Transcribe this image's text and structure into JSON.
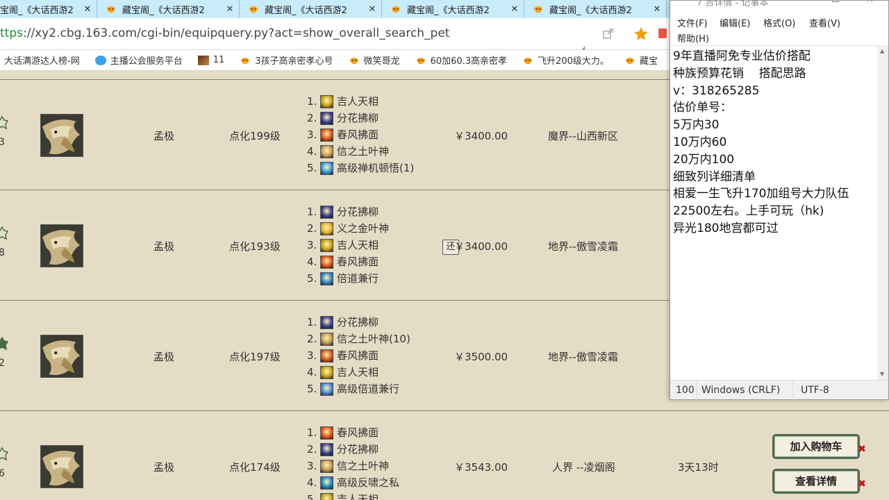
{
  "browser": {
    "tabs": [
      {
        "title": "宝阁_《大话西游2"
      },
      {
        "title": "藏宝阁_《大话西游2"
      },
      {
        "title": "藏宝阁_《大话西游2"
      },
      {
        "title": "藏宝阁_《大话西游2"
      },
      {
        "title": "藏宝阁_《大话西游2"
      },
      {
        "title": "藏宝阁_《大话西游2"
      }
    ],
    "tab_close_glyph": "✕",
    "url_scheme": "ttps",
    "url_rest": "://xy2.cbg.163.com/cgi-bin/equipquery.py?act=show_overall_search_pet",
    "bookmarks": [
      {
        "label": "大话满游达人榜-网",
        "icon": "none"
      },
      {
        "label": "主播公会服务平台",
        "icon": "cloud-icon"
      },
      {
        "label": "11",
        "icon": "game-icon"
      },
      {
        "label": "3孩子高亲密孝心号",
        "icon": "xy2-icon"
      },
      {
        "label": "微笑哥龙",
        "icon": "xy2-icon"
      },
      {
        "label": "60加60.3高亲密孝",
        "icon": "xy2-icon"
      },
      {
        "label": "飞升200级大力。",
        "icon": "xy2-icon"
      },
      {
        "label": "藏宝",
        "icon": "xy2-icon"
      }
    ]
  },
  "listing": {
    "rows": [
      {
        "index": "3",
        "name": "孟极",
        "level": "点化199级",
        "skills": [
          {
            "n": "1.",
            "name": "吉人天相",
            "color": "#c9a21a"
          },
          {
            "n": "2.",
            "name": "分花拂柳",
            "color": "#3a3e8e"
          },
          {
            "n": "3.",
            "name": "春风拂面",
            "color": "#e0541a"
          },
          {
            "n": "4.",
            "name": "信之土叶神",
            "color": "#c79a5a"
          },
          {
            "n": "5.",
            "name": "高级禅机顿悟(1)",
            "color": "#3a9ad8"
          }
        ],
        "bargain": "",
        "price": "￥3400.00",
        "server": "魔界--山西新区",
        "fav_filled": false
      },
      {
        "index": "8",
        "name": "孟极",
        "level": "点化193级",
        "skills": [
          {
            "n": "1.",
            "name": "分花拂柳",
            "color": "#3a3e8e"
          },
          {
            "n": "2.",
            "name": "义之金叶神",
            "color": "#e2b528"
          },
          {
            "n": "3.",
            "name": "吉人天相",
            "color": "#c9a21a"
          },
          {
            "n": "4.",
            "name": "春风拂面",
            "color": "#e0541a"
          },
          {
            "n": "5.",
            "name": "倍道兼行",
            "color": "#2f86c8"
          }
        ],
        "bargain": "还",
        "price": "￥3400.00",
        "server": "地界--傲雪凌霜",
        "fav_filled": false
      },
      {
        "index": "2",
        "name": "孟极",
        "level": "点化197级",
        "skills": [
          {
            "n": "1.",
            "name": "分花拂柳",
            "color": "#3a3e8e"
          },
          {
            "n": "2.",
            "name": "信之土叶神(10)",
            "color": "#c79a5a"
          },
          {
            "n": "3.",
            "name": "春风拂面",
            "color": "#e0541a"
          },
          {
            "n": "4.",
            "name": "吉人天相",
            "color": "#c9a21a"
          },
          {
            "n": "5.",
            "name": "高级倍道兼行",
            "color": "#4a8ad8"
          }
        ],
        "bargain": "",
        "price": "￥3500.00",
        "server": "地界--傲雪凌霜",
        "fav_filled": true
      },
      {
        "index": "6",
        "name": "孟极",
        "level": "点化174级",
        "skills": [
          {
            "n": "1.",
            "name": "春风拂面",
            "color": "#e0541a"
          },
          {
            "n": "2.",
            "name": "分花拂柳",
            "color": "#3a3e8e"
          },
          {
            "n": "3.",
            "name": "信之土叶神",
            "color": "#c79a5a"
          },
          {
            "n": "4.",
            "name": "高级反啸之私",
            "color": "#1a8ac8"
          },
          {
            "n": "5.",
            "name": "吉人天相",
            "color": "#c9a21a"
          }
        ],
        "bargain": "",
        "price": "￥3543.00",
        "server": "人界 --凌烟阁",
        "remaining": "3天13时",
        "fav_filled": false
      }
    ],
    "add_to_cart_label": "加入购物车",
    "view_detail_label": "查看详情",
    "remove_glyph": "✖"
  },
  "notepad": {
    "title": "7 吉详情 - 记事本",
    "menu": {
      "file": "文件(F)",
      "edit": "编辑(E)",
      "format": "格式(O)",
      "view": "查看(V)",
      "help": "帮助(H)"
    },
    "lines": [
      "9年直播阿免专业估价搭配",
      "种族预算花销    搭配思路",
      "v：318265285",
      "估价单号：",
      "5万内30",
      "10万内60",
      "20万内100",
      "细致列详细清单",
      "相爱一生飞升170加组号大力队伍",
      "22500左右。上手可玩（hk)",
      "异光180地宫都可过"
    ],
    "status": {
      "zoom": "100",
      "line_ending": "Windows (CRLF)",
      "encoding": "UTF-8"
    }
  }
}
